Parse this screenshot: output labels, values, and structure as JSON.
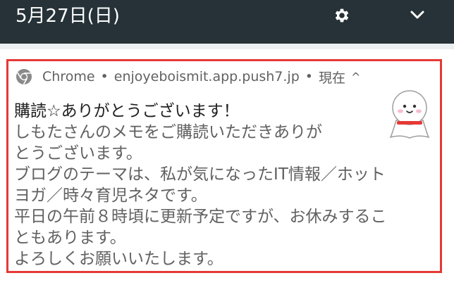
{
  "statusbar": {
    "date": "5月27日(日)",
    "settings_icon": "gear-icon",
    "expand_icon": "chevron-down-icon"
  },
  "notification": {
    "app_name": "Chrome",
    "separator": "•",
    "source": "enjoyeboismit.app.push7.jp",
    "time": "現在",
    "collapse_symbol": "^",
    "title": "購読☆ありがとうございます！",
    "body_lines": [
      "しもたさんのメモをご購読いただきありが",
      "とうございます。",
      "ブログのテーマは、私が気になったIT情報／ホット",
      "ヨガ／時々育児ネタです。",
      "平日の午前８時頃に更新予定ですが、お休みするこ",
      "ともあります。",
      "よろしくお願いいたします。"
    ],
    "large_icon": "teru-teru-bozu-avatar",
    "highlight_color": "#e53935"
  },
  "colors": {
    "statusbar_bg": "#263238",
    "background": "#eceff1",
    "card_bg": "#ffffff",
    "title_text": "#212121",
    "body_text": "#616161"
  }
}
